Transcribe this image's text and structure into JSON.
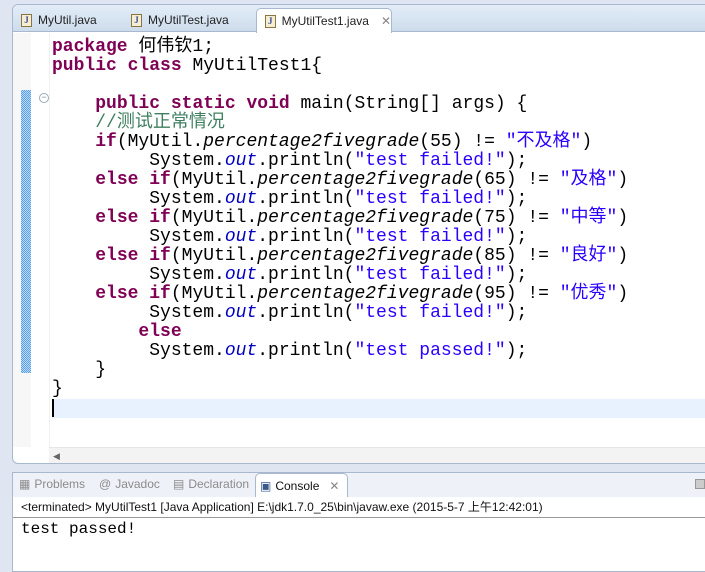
{
  "editor": {
    "tabs": [
      {
        "label": "MyUtil.java",
        "active": false
      },
      {
        "label": "MyUtilTest.java",
        "active": false
      },
      {
        "label": "MyUtilTest1.java",
        "active": true
      }
    ],
    "close_glyph": "✕",
    "lines": [
      [
        {
          "t": "package",
          "c": "kw"
        },
        {
          "t": " 何伟钦1;"
        }
      ],
      [
        {
          "t": "public",
          "c": "kw"
        },
        {
          "t": " "
        },
        {
          "t": "class",
          "c": "kw"
        },
        {
          "t": " MyUtilTest1{"
        }
      ],
      [],
      [
        {
          "t": "    "
        },
        {
          "t": "public",
          "c": "kw"
        },
        {
          "t": " "
        },
        {
          "t": "static",
          "c": "kw"
        },
        {
          "t": " "
        },
        {
          "t": "void",
          "c": "kw"
        },
        {
          "t": " main(String[] args) {"
        }
      ],
      [
        {
          "t": "    "
        },
        {
          "t": "//测试正常情况",
          "c": "com"
        }
      ],
      [
        {
          "t": "    "
        },
        {
          "t": "if",
          "c": "kw"
        },
        {
          "t": "(MyUtil."
        },
        {
          "t": "percentage2fivegrade",
          "c": "mth"
        },
        {
          "t": "(55) != "
        },
        {
          "t": "\"不及格\"",
          "c": "str"
        },
        {
          "t": ")"
        }
      ],
      [
        {
          "t": "         System."
        },
        {
          "t": "out",
          "c": "fld"
        },
        {
          "t": ".println("
        },
        {
          "t": "\"test failed!\"",
          "c": "str"
        },
        {
          "t": ");"
        }
      ],
      [
        {
          "t": "    "
        },
        {
          "t": "else",
          "c": "kw"
        },
        {
          "t": " "
        },
        {
          "t": "if",
          "c": "kw"
        },
        {
          "t": "(MyUtil."
        },
        {
          "t": "percentage2fivegrade",
          "c": "mth"
        },
        {
          "t": "(65) != "
        },
        {
          "t": "\"及格\"",
          "c": "str"
        },
        {
          "t": ")"
        }
      ],
      [
        {
          "t": "         System."
        },
        {
          "t": "out",
          "c": "fld"
        },
        {
          "t": ".println("
        },
        {
          "t": "\"test failed!\"",
          "c": "str"
        },
        {
          "t": ");"
        }
      ],
      [
        {
          "t": "    "
        },
        {
          "t": "else",
          "c": "kw"
        },
        {
          "t": " "
        },
        {
          "t": "if",
          "c": "kw"
        },
        {
          "t": "(MyUtil."
        },
        {
          "t": "percentage2fivegrade",
          "c": "mth"
        },
        {
          "t": "(75) != "
        },
        {
          "t": "\"中等\"",
          "c": "str"
        },
        {
          "t": ")"
        }
      ],
      [
        {
          "t": "         System."
        },
        {
          "t": "out",
          "c": "fld"
        },
        {
          "t": ".println("
        },
        {
          "t": "\"test failed!\"",
          "c": "str"
        },
        {
          "t": ");"
        }
      ],
      [
        {
          "t": "    "
        },
        {
          "t": "else",
          "c": "kw"
        },
        {
          "t": " "
        },
        {
          "t": "if",
          "c": "kw"
        },
        {
          "t": "(MyUtil."
        },
        {
          "t": "percentage2fivegrade",
          "c": "mth"
        },
        {
          "t": "(85) != "
        },
        {
          "t": "\"良好\"",
          "c": "str"
        },
        {
          "t": ")"
        }
      ],
      [
        {
          "t": "         System."
        },
        {
          "t": "out",
          "c": "fld"
        },
        {
          "t": ".println("
        },
        {
          "t": "\"test failed!\"",
          "c": "str"
        },
        {
          "t": ");"
        }
      ],
      [
        {
          "t": "    "
        },
        {
          "t": "else",
          "c": "kw"
        },
        {
          "t": " "
        },
        {
          "t": "if",
          "c": "kw"
        },
        {
          "t": "(MyUtil."
        },
        {
          "t": "percentage2fivegrade",
          "c": "mth"
        },
        {
          "t": "(95) != "
        },
        {
          "t": "\"优秀\"",
          "c": "str"
        },
        {
          "t": ")"
        }
      ],
      [
        {
          "t": "         System."
        },
        {
          "t": "out",
          "c": "fld"
        },
        {
          "t": ".println("
        },
        {
          "t": "\"test failed!\"",
          "c": "str"
        },
        {
          "t": ");"
        }
      ],
      [
        {
          "t": "        "
        },
        {
          "t": "else",
          "c": "kw"
        }
      ],
      [
        {
          "t": "         System."
        },
        {
          "t": "out",
          "c": "fld"
        },
        {
          "t": ".println("
        },
        {
          "t": "\"test passed!\"",
          "c": "str"
        },
        {
          "t": ");"
        }
      ],
      [
        {
          "t": "    }"
        }
      ],
      [
        {
          "t": "}"
        }
      ]
    ]
  },
  "panel": {
    "tabs": [
      {
        "label": "Problems",
        "icon": "problems-icon"
      },
      {
        "label": "Javadoc",
        "icon": "at-icon"
      },
      {
        "label": "Declaration",
        "icon": "declaration-icon"
      },
      {
        "label": "Console",
        "icon": "console-icon",
        "active": true
      }
    ],
    "status": "<terminated> MyUtilTest1 [Java Application] E:\\jdk1.7.0_25\\bin\\javaw.exe (2015-5-7 上午12:42:01)",
    "output": "test passed!"
  },
  "colors": {
    "keyword": "#7f0055",
    "string": "#2a00ff",
    "comment": "#3f7f5f",
    "field": "#0000c0"
  }
}
